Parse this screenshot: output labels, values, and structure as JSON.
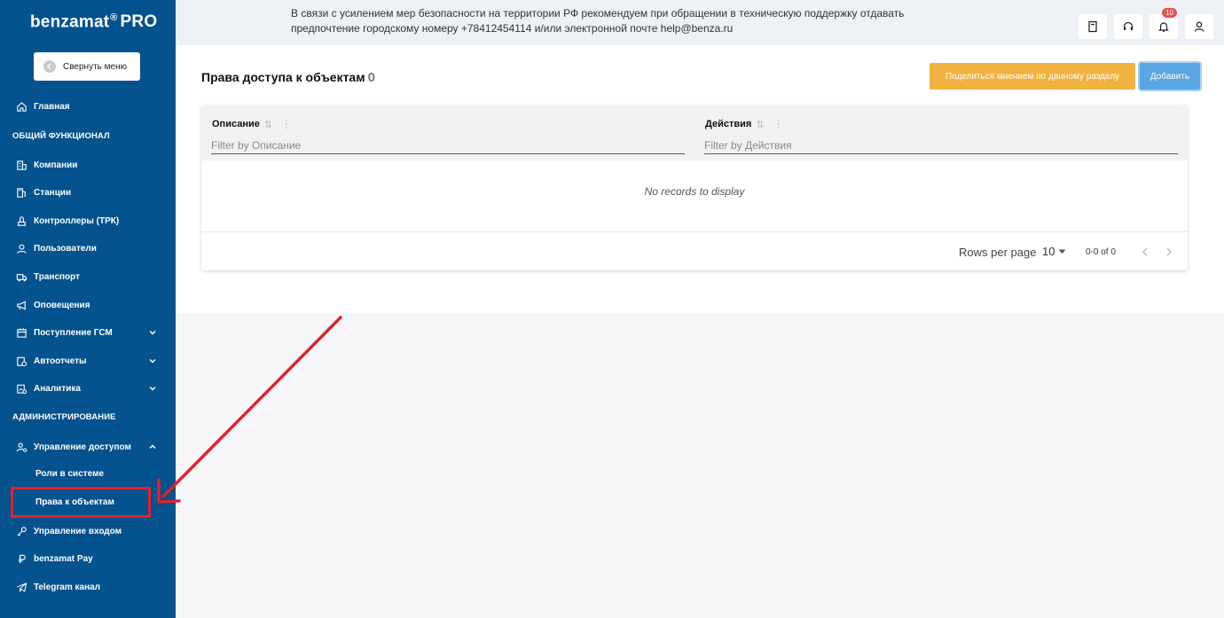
{
  "app": {
    "logo_name": "benzamat",
    "logo_mark": "®",
    "logo_suffix": "PRO"
  },
  "sidebar": {
    "collapse_label": "Свернуть меню",
    "home": "Главная",
    "section_general": "ОБЩИЙ ФУНКЦИОНАЛ",
    "companies": "Компании",
    "stations": "Станции",
    "controllers": "Контроллеры (ТРК)",
    "users": "Пользователи",
    "transport": "Транспорт",
    "notifications": "Оповещения",
    "fuel_receipt": "Поступление ГСМ",
    "autoreports": "Автоотчеты",
    "analytics": "Аналитика",
    "section_admin": "АДМИНИСТРИРОВАНИЕ",
    "access_control": "Управление доступом",
    "roles": "Роли в системе",
    "object_rights": "Права к объектам",
    "login_control": "Управление входом",
    "pay": "benzamat Pay",
    "telegram": "Telegram канал"
  },
  "topbar": {
    "notice_line1": "В связи с усилением мер безопасности на территории РФ рекомендуем при обращении в техническую поддержку отдавать",
    "notice_line2": "предпочтение городскому номеру +78412454114 и/или электронной почте help@benza.ru",
    "notification_count": "10"
  },
  "main": {
    "title": "Права доступа к объектам",
    "count": "0",
    "feedback_button": "Поделиться мнением по данному разделу",
    "add_button": "Добавить"
  },
  "table": {
    "col_description": "Описание",
    "col_actions": "Действия",
    "filter_description_placeholder": "Filter by Описание",
    "filter_actions_placeholder": "Filter by Действия",
    "empty": "No records to display",
    "rows_per_page_label": "Rows per page",
    "rows_per_page_value": "10",
    "range": "0-0 of 0"
  },
  "colors": {
    "sidebar": "#04528e",
    "highlight": "#e0232a",
    "feedback": "#f0b340",
    "add": "#5aa5e3"
  }
}
